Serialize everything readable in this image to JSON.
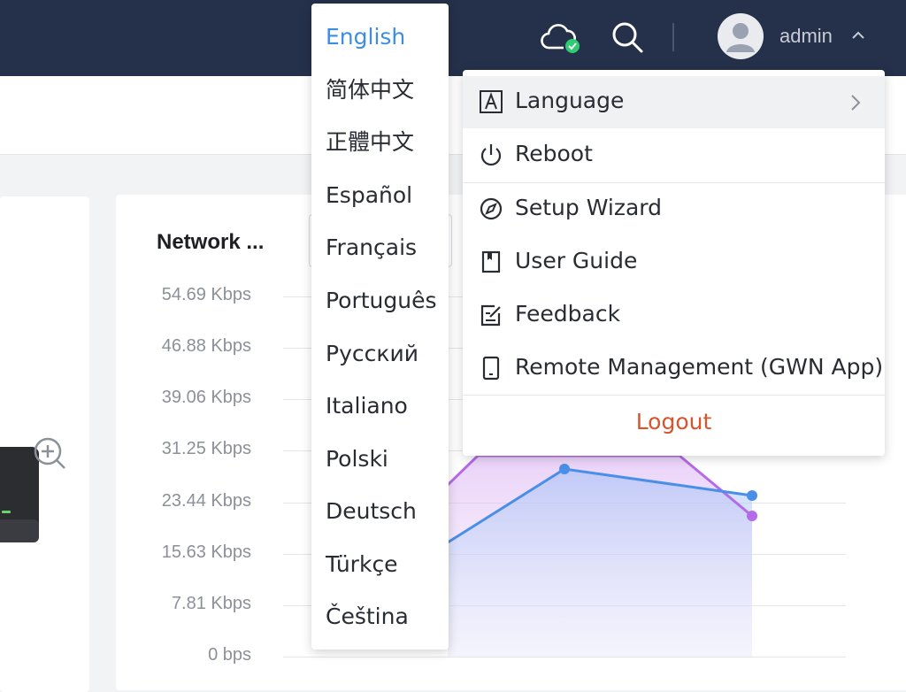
{
  "header": {
    "username": "admin",
    "cloud_icon": "cloud-check-icon",
    "search_icon": "search-icon",
    "colors": {
      "bar": "#25304a",
      "cloud_ok": "#2ecc71"
    }
  },
  "card": {
    "title": "Network ..."
  },
  "chart_data": {
    "type": "line",
    "y_ticks": [
      "54.69 Kbps",
      "46.88 Kbps",
      "39.06 Kbps",
      "31.25 Kbps",
      "23.44 Kbps",
      "15.63 Kbps",
      "7.81 Kbps",
      "0 bps"
    ],
    "ylim": [
      0,
      54.69
    ],
    "series": [
      {
        "color": "#4a8fe7",
        "points": [
          [
            506,
            613
          ],
          [
            638,
            530
          ],
          [
            850,
            560
          ]
        ]
      },
      {
        "color": "#b56ae8",
        "points": [
          [
            506,
            548
          ],
          [
            540,
            515
          ],
          [
            768,
            515
          ],
          [
            850,
            583
          ]
        ]
      }
    ]
  },
  "language_menu": {
    "selected": "English",
    "items": [
      "English",
      "简体中文",
      "正體中文",
      "Español",
      "Français",
      "Português",
      "Русский",
      "Italiano",
      "Polski",
      "Deutsch",
      "Türkçe",
      "Čeština"
    ],
    "active_color": "#3d8ee0"
  },
  "user_menu": {
    "items": [
      {
        "label": "Language",
        "icon": "language-icon"
      },
      {
        "label": "Reboot",
        "icon": "power-icon"
      },
      {
        "label": "Setup Wizard",
        "icon": "compass-icon"
      },
      {
        "label": "User Guide",
        "icon": "book-icon"
      },
      {
        "label": "Feedback",
        "icon": "feedback-icon"
      },
      {
        "label": "Remote Management (GWN App)",
        "icon": "phone-icon"
      }
    ],
    "logout": "Logout",
    "logout_color": "#d9532c"
  }
}
